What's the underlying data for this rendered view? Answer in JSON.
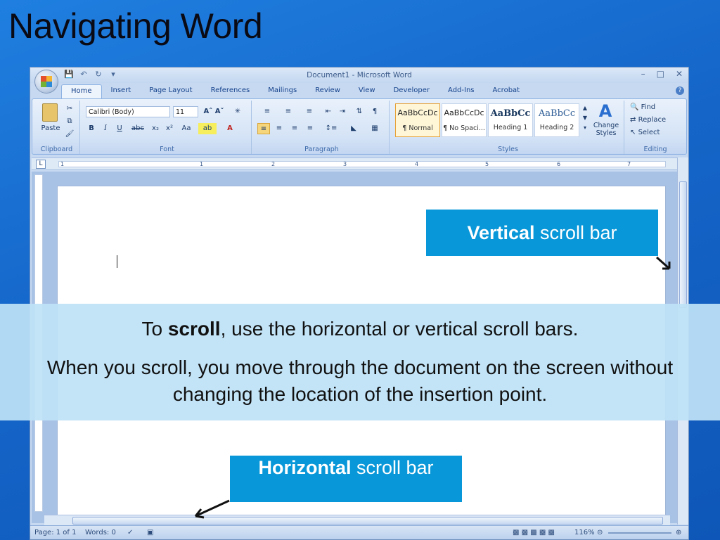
{
  "slide": {
    "title": "Navigating Word",
    "vertical_callout": {
      "bold": "Vertical",
      "rest": " scroll bar"
    },
    "horizontal_callout": {
      "bold": "Horizontal",
      "rest": " scroll bar"
    },
    "banner": {
      "line1_pre": "To ",
      "line1_bold": "scroll",
      "line1_post": ", use the horizontal or vertical scroll bars.",
      "line2": "When you scroll, you move through the document on the screen without changing the location of the insertion point."
    }
  },
  "window": {
    "title": "Document1 - Microsoft Word",
    "controls": [
      "–",
      "□",
      "✕"
    ]
  },
  "ribbon": {
    "tabs": [
      "Home",
      "Insert",
      "Page Layout",
      "References",
      "Mailings",
      "Review",
      "View",
      "Developer",
      "Add-Ins",
      "Acrobat"
    ],
    "active_tab": "Home",
    "clipboard": {
      "paste": "Paste",
      "label": "Clipboard"
    },
    "font": {
      "name": "Calibri (Body)",
      "size": "11",
      "label": "Font"
    },
    "paragraph": {
      "label": "Paragraph"
    },
    "styles": {
      "label": "Styles",
      "items": [
        {
          "sample": "AaBbCcDc",
          "name": "¶ Normal"
        },
        {
          "sample": "AaBbCcDc",
          "name": "¶ No Spaci..."
        },
        {
          "sample": "AaBbCc",
          "name": "Heading 1"
        },
        {
          "sample": "AaBbCc",
          "name": "Heading 2"
        }
      ],
      "change_styles": "Change Styles"
    },
    "editing": {
      "label": "Editing",
      "find": "Find",
      "replace": "Replace",
      "select": "Select"
    }
  },
  "status": {
    "page": "Page: 1 of 1",
    "words": "Words: 0",
    "zoom": "116%"
  }
}
